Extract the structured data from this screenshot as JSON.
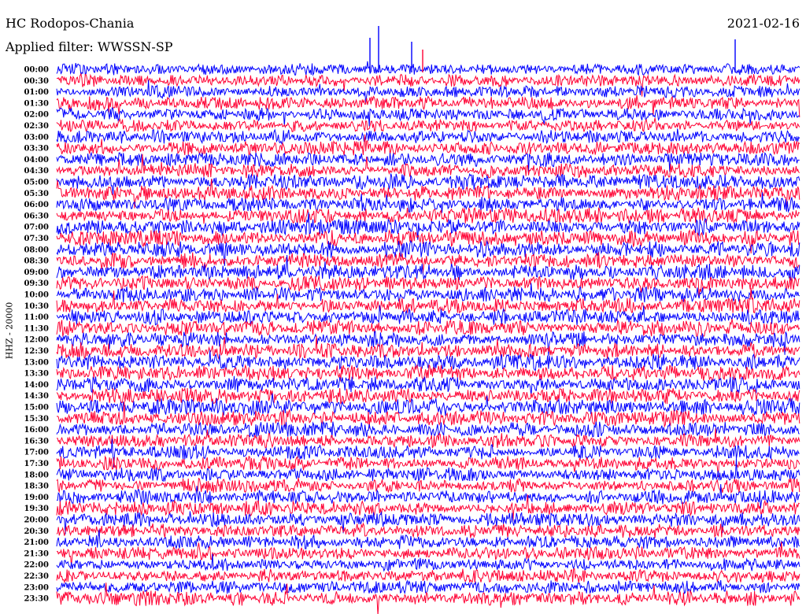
{
  "header": {
    "station": "HC Rodopos-Chania",
    "date": "2021-02-16",
    "filter": "Applied filter: WWSSN-SP",
    "channel": "HHZ - 20000"
  },
  "colors": {
    "trace_a": "#0000ff",
    "trace_b": "#ff0033",
    "background": "#ffffff"
  },
  "chart_data": {
    "type": "helicorder",
    "title": "HC Rodopos-Chania",
    "subtitle": "Applied filter: WWSSN-SP",
    "date": "2021-02-16",
    "ylabel": "HHZ - 20000",
    "rows": [
      "00:00",
      "00:30",
      "01:00",
      "01:30",
      "02:00",
      "02:30",
      "03:00",
      "03:30",
      "04:00",
      "04:30",
      "05:00",
      "05:30",
      "06:00",
      "06:30",
      "07:00",
      "07:30",
      "08:00",
      "08:30",
      "09:00",
      "09:30",
      "10:00",
      "10:30",
      "11:00",
      "11:30",
      "12:00",
      "12:30",
      "13:00",
      "13:30",
      "14:00",
      "14:30",
      "15:00",
      "15:30",
      "16:00",
      "16:30",
      "17:00",
      "17:30",
      "18:00",
      "18:30",
      "19:00",
      "19:30",
      "20:00",
      "20:30",
      "21:00",
      "21:30",
      "22:00",
      "22:30",
      "23:00",
      "23:30"
    ],
    "row_colors": [
      "#0000ff",
      "#ff0033"
    ],
    "trace_activity": [
      0.7,
      0.75,
      0.75,
      0.8,
      0.75,
      0.75,
      0.8,
      0.85,
      0.85,
      0.85,
      0.9,
      0.9,
      0.9,
      0.9,
      0.95,
      0.95,
      0.95,
      0.95,
      0.95,
      0.9,
      0.9,
      0.9,
      0.95,
      0.95,
      0.95,
      0.95,
      0.95,
      0.95,
      0.95,
      0.95,
      1.0,
      0.95,
      0.9,
      0.85,
      0.85,
      0.85,
      0.85,
      0.85,
      0.85,
      0.85,
      0.85,
      0.85,
      0.8,
      0.8,
      0.8,
      0.8,
      0.8,
      0.85
    ],
    "grid": false,
    "legend": "none"
  }
}
